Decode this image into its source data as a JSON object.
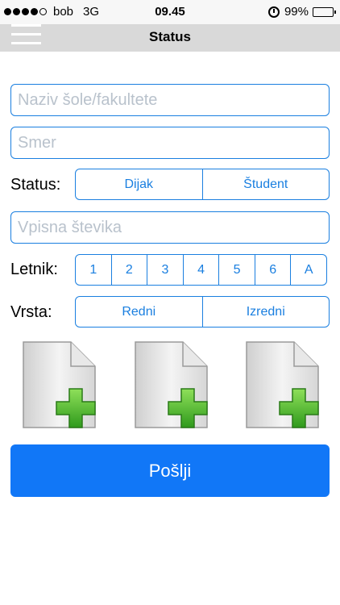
{
  "status_bar": {
    "carrier": "bob",
    "network": "3G",
    "time": "09.45",
    "battery": "99%",
    "signal_bars": 4,
    "signal_total": 5
  },
  "nav": {
    "title": "Status",
    "menu_icon": "hamburger-menu-icon"
  },
  "form": {
    "school_placeholder": "Naziv šole/fakultete",
    "school_value": "",
    "direction_placeholder": "Smer",
    "direction_value": "",
    "status_label": "Status:",
    "status_options": [
      "Dijak",
      "Študent"
    ],
    "enrollment_placeholder": "Vpisna števika",
    "enrollment_value": "",
    "year_label": "Letnik:",
    "year_options": [
      "1",
      "2",
      "3",
      "4",
      "5",
      "6",
      "A"
    ],
    "type_label": "Vrsta:",
    "type_options": [
      "Redni",
      "Izredni"
    ],
    "attachments": [
      "add-document-icon",
      "add-document-icon",
      "add-document-icon"
    ],
    "submit_label": "Pošlji"
  },
  "colors": {
    "accent": "#1a7fe0",
    "button": "#1177f7",
    "navbar": "#d9d9d9",
    "plus_green": "#4cbb2a"
  }
}
